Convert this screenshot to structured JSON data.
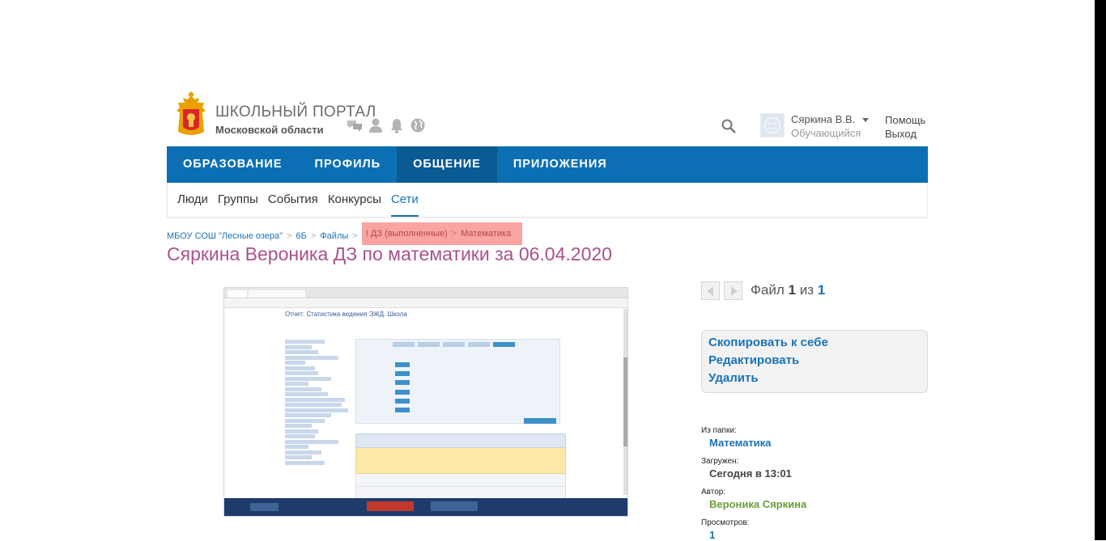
{
  "brand": {
    "title": "ШКОЛЬНЫЙ ПОРТАЛ",
    "subtitle": "Московской области"
  },
  "header_icons": [
    "chat-icon",
    "user-icon",
    "bell-icon",
    "globe-icon"
  ],
  "user": {
    "name": "Сяркина В.В.",
    "role": "Обучающийся",
    "help": "Помощь",
    "logout": "Выход"
  },
  "main_nav": [
    {
      "label": "ОБРАЗОВАНИЕ",
      "active": false
    },
    {
      "label": "ПРОФИЛЬ",
      "active": false
    },
    {
      "label": "ОБЩЕНИЕ",
      "active": true
    },
    {
      "label": "ПРИЛОЖЕНИЯ",
      "active": false
    }
  ],
  "sub_nav": [
    {
      "label": "Люди",
      "active": false
    },
    {
      "label": "Группы",
      "active": false
    },
    {
      "label": "События",
      "active": false
    },
    {
      "label": "Конкурсы",
      "active": false
    },
    {
      "label": "Сети",
      "active": true
    }
  ],
  "breadcrumbs": {
    "items": [
      "МБОУ СОШ \"Лесные озера\"",
      "6Б",
      "Файлы"
    ],
    "highlighted": [
      "! ДЗ (выполненные)",
      "Математика"
    ],
    "separator": ">"
  },
  "page_title": "Сяркина Вероника ДЗ по математики за 06.04.2020",
  "preview": {
    "report_title": "Отчет: Статистика ведения ЭЖД. Школа"
  },
  "pager": {
    "label": "Файл",
    "current": "1",
    "of": "из",
    "total": "1"
  },
  "actions": {
    "copy": "Скопировать к себе",
    "edit": "Редактировать",
    "delete": "Удалить"
  },
  "meta": {
    "folder_label": "Из папки:",
    "folder_value": "Математика",
    "uploaded_label": "Загружен:",
    "uploaded_value": "Сегодня в 13:01",
    "author_label": "Автор:",
    "author_value": "Вероника Сяркина",
    "views_label": "Просмотров:",
    "views_value": "1"
  },
  "colors": {
    "nav_blue": "#0d6fb3",
    "nav_active": "#0a5a93",
    "title_purple": "#a8528a",
    "link_blue": "#1a73b8",
    "highlight_red": "#f9a3a3",
    "author_green": "#6a9c3a"
  }
}
